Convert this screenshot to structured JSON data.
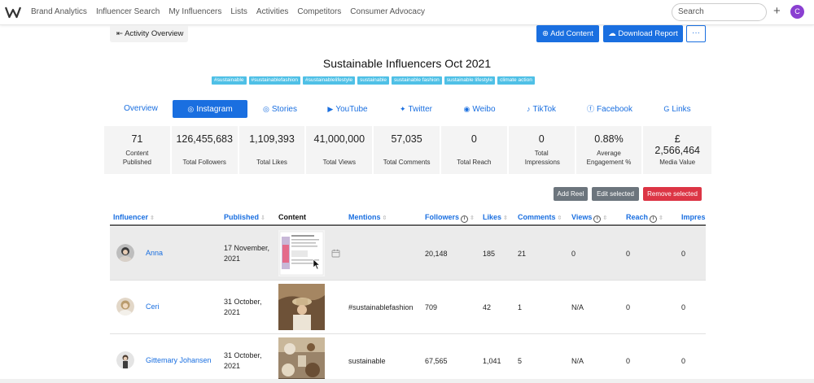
{
  "nav": {
    "items": [
      "Brand Analytics",
      "Influencer Search",
      "My Influencers",
      "Lists",
      "Activities",
      "Competitors",
      "Consumer Advocacy"
    ],
    "search_placeholder": "Search",
    "plus": "+",
    "user_initial": "C"
  },
  "toolbar": {
    "back_label": "Activity Overview",
    "add_content_label": "Add Content",
    "download_label": "Download Report",
    "more_label": "···"
  },
  "activity": {
    "title": "Sustainable Influencers Oct 2021",
    "tags": [
      "#sustainable",
      "#sustainablefashion",
      "#sustainablelifestyle",
      "sustainable",
      "sustainable fashion",
      "sustainable lifestyle",
      "climate action"
    ]
  },
  "tabs": [
    "Overview",
    "Instagram",
    "Stories",
    "YouTube",
    "Twitter",
    "Weibo",
    "TikTok",
    "Facebook",
    "Links"
  ],
  "active_tab": "Instagram",
  "stats": [
    {
      "value": "71",
      "label": "Content Published"
    },
    {
      "value": "126,455,683",
      "label": "Total Followers"
    },
    {
      "value": "1,109,393",
      "label": "Total Likes"
    },
    {
      "value": "41,000,000",
      "label": "Total Views"
    },
    {
      "value": "57,035",
      "label": "Total Comments"
    },
    {
      "value": "0",
      "label": "Total Reach"
    },
    {
      "value": "0",
      "label": "Total Impressions"
    },
    {
      "value": "0.88%",
      "label": "Average Engagement %"
    },
    {
      "value": "£ 2,566,464",
      "label": "Media Value"
    }
  ],
  "table_actions": {
    "add_reel": "Add Reel",
    "edit_selected": "Edit selected",
    "remove_selected": "Remove selected"
  },
  "table": {
    "headers": {
      "influencer": "Influencer",
      "published": "Published",
      "content": "Content",
      "mentions": "Mentions",
      "followers": "Followers",
      "likes": "Likes",
      "comments": "Comments",
      "views": "Views",
      "reach": "Reach",
      "impressions": "Impres"
    },
    "rows": [
      {
        "influencer": "Anna",
        "published_line1": "17 November,",
        "published_line2": "2021",
        "mentions": "",
        "followers": "20,148",
        "likes": "185",
        "comments": "21",
        "views": "0",
        "reach": "0",
        "impressions": "0"
      },
      {
        "influencer": "Ceri",
        "published_line1": "31 October,",
        "published_line2": "2021",
        "mentions": "#sustainablefashion",
        "followers": "709",
        "likes": "42",
        "comments": "1",
        "views": "N/A",
        "reach": "0",
        "impressions": "0"
      },
      {
        "influencer": "Gittemary Johansen",
        "published_line1": "31 October,",
        "published_line2": "2021",
        "mentions": "sustainable",
        "followers": "67,565",
        "likes": "1,041",
        "comments": "5",
        "views": "N/A",
        "reach": "0",
        "impressions": "0"
      }
    ]
  },
  "colors": {
    "primary": "#1a6fe0",
    "tag": "#4fc0e6",
    "danger": "#dc3545",
    "secondary": "#6c757d",
    "user_avatar": "#8a3fd1"
  }
}
